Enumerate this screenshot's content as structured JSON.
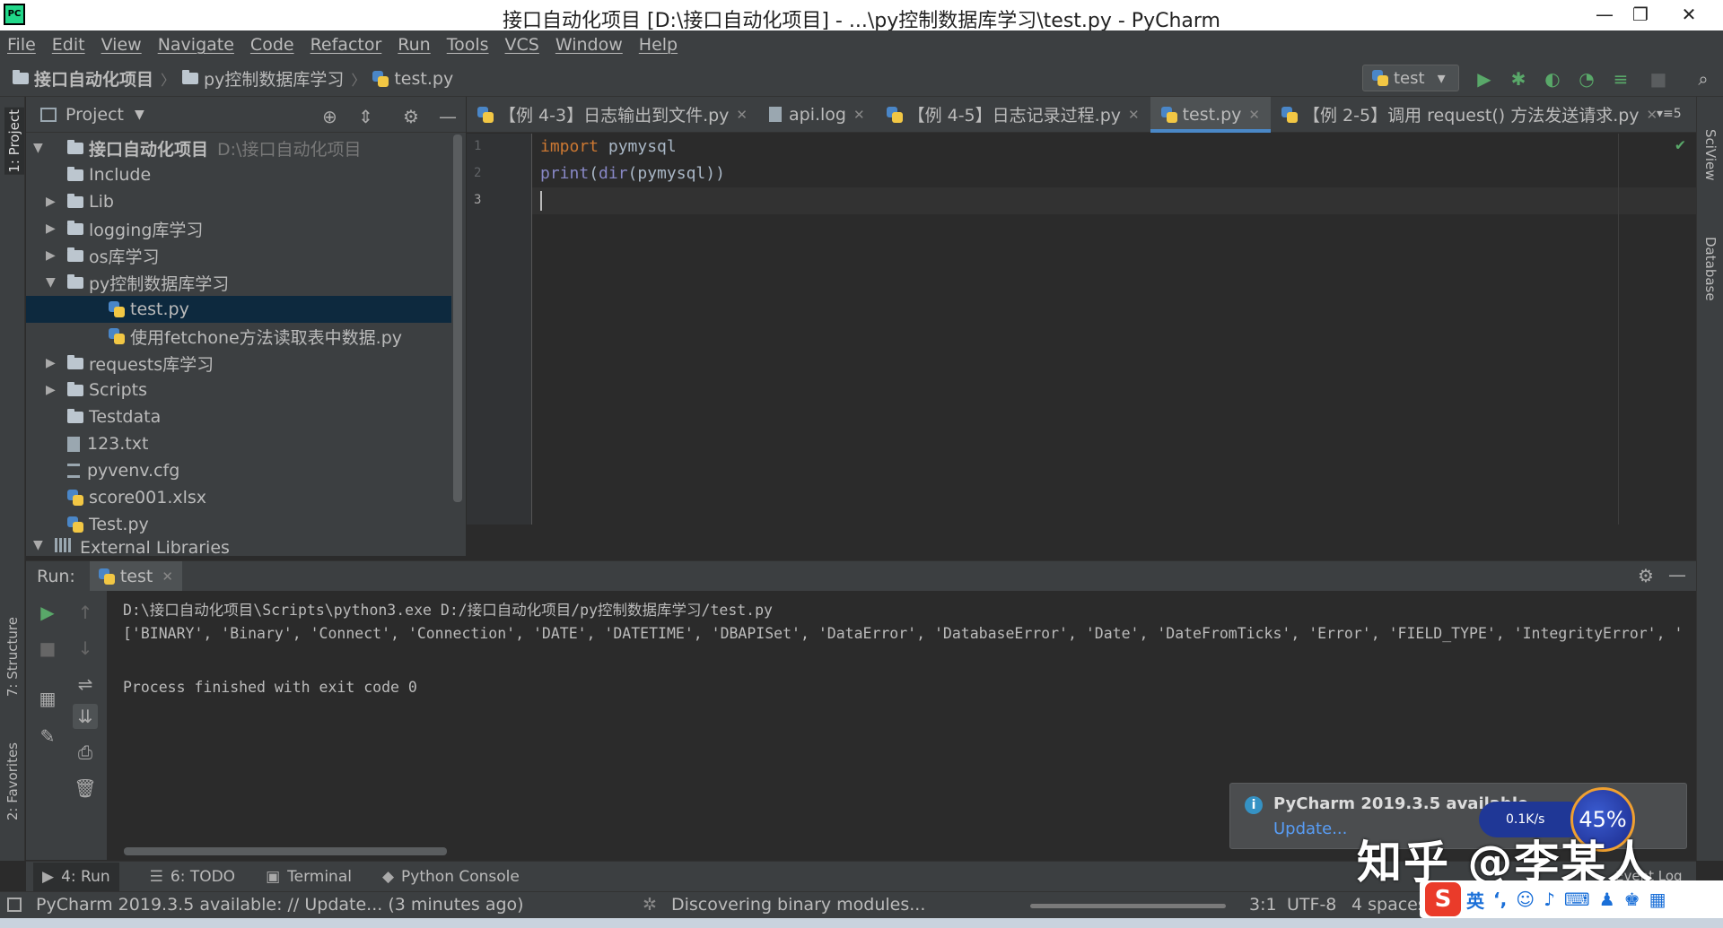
{
  "window": {
    "title": "接口自动化项目 [D:\\接口自动化项目] - ...\\py控制数据库学习\\test.py - PyCharm",
    "app_icon": "PC",
    "controls": {
      "minimize": "—",
      "maximize": "❐",
      "close": "✕"
    }
  },
  "menu": [
    "File",
    "Edit",
    "View",
    "Navigate",
    "Code",
    "Refactor",
    "Run",
    "Tools",
    "VCS",
    "Window",
    "Help"
  ],
  "breadcrumb": {
    "project": "接口自动化项目",
    "folder": "py控制数据库学习",
    "file": "test.py"
  },
  "run_config": {
    "name": "test",
    "arrow": "▾"
  },
  "left_stripe": {
    "project": "1: Project",
    "structure": "7: Structure",
    "favorites": "2: Favorites"
  },
  "right_stripe": {
    "sciview": "SciView",
    "database": "Database"
  },
  "project_panel": {
    "title": "Project",
    "root": {
      "name": "接口自动化项目",
      "path": "D:\\接口自动化项目"
    },
    "items": [
      {
        "name": "Include"
      },
      {
        "name": "Lib"
      },
      {
        "name": "logging库学习"
      },
      {
        "name": "os库学习"
      },
      {
        "name": "py控制数据库学习"
      },
      {
        "name": "test.py"
      },
      {
        "name": "使用fetchone方法读取表中数据.py"
      },
      {
        "name": "requests库学习"
      },
      {
        "name": "Scripts"
      },
      {
        "name": "Testdata"
      },
      {
        "name": "123.txt"
      },
      {
        "name": "pyvenv.cfg"
      },
      {
        "name": "score001.xlsx"
      },
      {
        "name": "Test.py"
      },
      {
        "name": "External Libraries"
      }
    ]
  },
  "tabs": [
    {
      "label": "【例 4-3】日志输出到文件.py"
    },
    {
      "label": "api.log"
    },
    {
      "label": "【例 4-5】日志记录过程.py"
    },
    {
      "label": "test.py"
    },
    {
      "label": "【例 2-5】调用 request() 方法发送请求.py"
    }
  ],
  "tabs_overflow": "▾≡5",
  "editor": {
    "line_numbers": [
      "1",
      "2",
      "3"
    ],
    "line1": {
      "kw": "import",
      "rest": " pymysql"
    },
    "line2": {
      "fn": "print",
      "open": "(",
      "fn2": "dir",
      "rest": "(pymysql))"
    }
  },
  "run_panel": {
    "label": "Run:",
    "tab": "test",
    "lines": [
      "D:\\接口自动化项目\\Scripts\\python3.exe D:/接口自动化项目/py控制数据库学习/test.py",
      "['BINARY', 'Binary', 'Connect', 'Connection', 'DATE', 'DATETIME', 'DBAPISet', 'DataError', 'DatabaseError', 'Date', 'DateFromTicks', 'Error', 'FIELD_TYPE', 'IntegrityError', '",
      "",
      "Process finished with exit code 0"
    ]
  },
  "bottom_tools": [
    {
      "label": "4: Run",
      "icon": "▶"
    },
    {
      "label": "6: TODO",
      "icon": "☰"
    },
    {
      "label": "Terminal",
      "icon": "▣"
    },
    {
      "label": "Python Console",
      "icon": "◆"
    }
  ],
  "status": {
    "message": "PyCharm 2019.3.5 available: // Update... (3 minutes ago)",
    "task": "Discovering binary modules...",
    "position": "3:1",
    "encoding": "UTF-8",
    "indent": "4 spaces"
  },
  "notification": {
    "title": "PyCharm 2019.3.5 available",
    "link": "Update..."
  },
  "event_log": "Event Log",
  "overlay": {
    "watermark": "知乎 @李某人",
    "speed": "0.1K/s",
    "percent": "45%",
    "ime_logo": "S",
    "ime_lang": "英"
  }
}
